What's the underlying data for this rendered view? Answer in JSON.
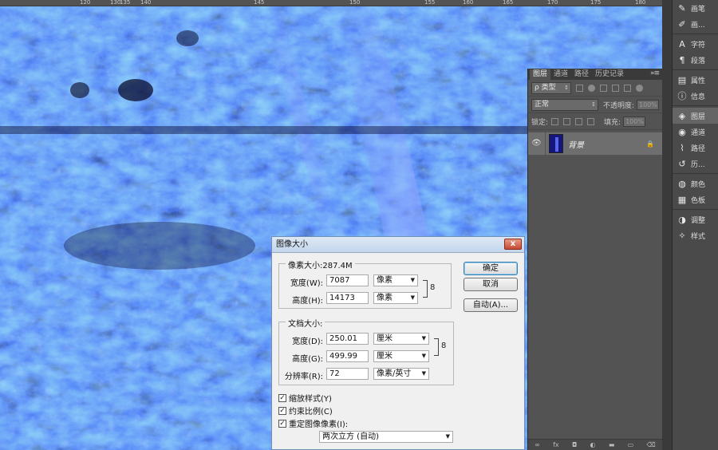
{
  "ruler": {
    "ticks": [
      "120",
      "130",
      "135",
      "140",
      "145",
      "150",
      "155",
      "160",
      "165",
      "170",
      "175",
      "180"
    ]
  },
  "canvas": {
    "image": "blue-marble-texture"
  },
  "layers_panel": {
    "tabs": [
      "图层",
      "通道",
      "路径",
      "历史记录"
    ],
    "menu_glyph": "»≡",
    "filter_label": "ρ 类型",
    "blend_mode": "正常",
    "opacity_label": "不透明度:",
    "opacity_value": "100%",
    "lock_label": "锁定:",
    "fill_label": "填充:",
    "fill_value": "100%",
    "layer_name": "背景",
    "footer_icons": [
      "link-icon",
      "fx-icon",
      "mask-icon",
      "adjustment-icon",
      "group-icon",
      "new-layer-icon",
      "trash-icon"
    ],
    "footer_glyphs": [
      "∞",
      "fx",
      "◘",
      "◐",
      "▬",
      "▭",
      "⌫"
    ]
  },
  "dock": {
    "items": [
      {
        "icon": "brush-icon",
        "glyph": "✎",
        "label": "画笔"
      },
      {
        "icon": "brush-preset-icon",
        "glyph": "✐",
        "label": "画..."
      },
      {
        "icon": "character-icon",
        "glyph": "A",
        "label": "字符"
      },
      {
        "icon": "paragraph-icon",
        "glyph": "¶",
        "label": "段落"
      },
      {
        "icon": "properties-icon",
        "glyph": "▤",
        "label": "属性"
      },
      {
        "icon": "info-icon",
        "glyph": "ⓘ",
        "label": "信息"
      },
      {
        "icon": "layers-icon",
        "glyph": "◈",
        "label": "图层"
      },
      {
        "icon": "channels-icon",
        "glyph": "◉",
        "label": "通道"
      },
      {
        "icon": "paths-icon",
        "glyph": "⌇",
        "label": "路径"
      },
      {
        "icon": "history-icon",
        "glyph": "↺",
        "label": "历..."
      },
      {
        "icon": "color-icon",
        "glyph": "◍",
        "label": "颜色"
      },
      {
        "icon": "swatches-icon",
        "glyph": "▦",
        "label": "色板"
      },
      {
        "icon": "adjustments-icon",
        "glyph": "◑",
        "label": "调整"
      },
      {
        "icon": "styles-icon",
        "glyph": "✧",
        "label": "样式"
      }
    ]
  },
  "dialog": {
    "title": "图像大小",
    "close_glyph": "x",
    "pixel_dims": {
      "legend": "像素大小:287.4M",
      "width_label": "宽度(W):",
      "width_value": "7087",
      "width_unit": "像素",
      "height_label": "高度(H):",
      "height_value": "14173",
      "height_unit": "像素"
    },
    "doc_size": {
      "legend": "文档大小:",
      "width_label": "宽度(D):",
      "width_value": "250.01",
      "width_unit": "厘米",
      "height_label": "高度(G):",
      "height_value": "499.99",
      "height_unit": "厘米",
      "res_label": "分辨率(R):",
      "res_value": "72",
      "res_unit": "像素/英寸"
    },
    "link_glyph": "8",
    "buttons": {
      "ok": "确定",
      "cancel": "取消",
      "auto": "自动(A)..."
    },
    "checkboxes": [
      {
        "label": "缩放样式(Y)",
        "checked": true
      },
      {
        "label": "约束比例(C)",
        "checked": true
      },
      {
        "label": "重定图像像素(I):",
        "checked": true
      }
    ],
    "check_glyph": "✓",
    "resample_method": "两次立方 (自动)"
  }
}
